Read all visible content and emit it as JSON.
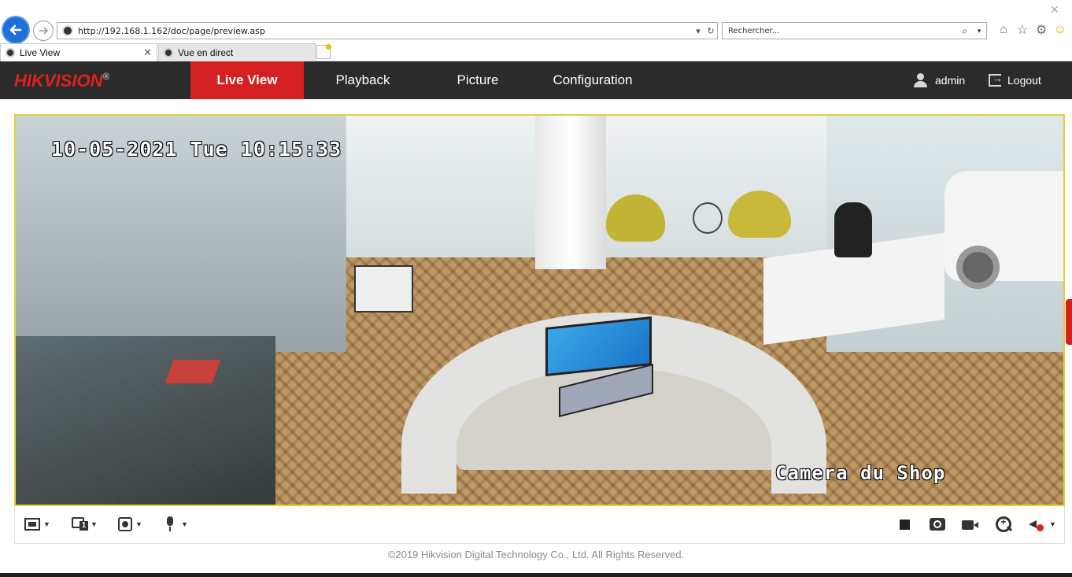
{
  "browser": {
    "url": "http://192.168.1.162/doc/page/preview.asp",
    "search_placeholder": "Rechercher...",
    "tabs": [
      {
        "label": "Live View",
        "active": true
      },
      {
        "label": "Vue en direct",
        "active": false
      }
    ]
  },
  "header": {
    "logo_text_hik": "HIK",
    "logo_text_vision": "VISION",
    "logo_reg": "®",
    "nav": [
      {
        "label": "Live View",
        "active": true
      },
      {
        "label": "Playback",
        "active": false
      },
      {
        "label": "Picture",
        "active": false
      },
      {
        "label": "Configuration",
        "active": false
      }
    ],
    "user": "admin",
    "logout": "Logout",
    "accent_color": "#d42021"
  },
  "video": {
    "osd_timestamp": "10-05-2021 Tue 10:15:33",
    "osd_camera_name": "Camera du Shop",
    "border_color": "#e8cf3a"
  },
  "toolbar": {
    "left_buttons": [
      "window-layout-icon",
      "stream-type-icon",
      "capture-mode-icon",
      "microphone-icon"
    ],
    "right_buttons": [
      "stop-icon",
      "camera-icon",
      "record-icon",
      "zoom-icon",
      "audio-muted-icon"
    ]
  },
  "footer": {
    "copyright": "©2019 Hikvision Digital Technology Co., Ltd. All Rights Reserved."
  }
}
